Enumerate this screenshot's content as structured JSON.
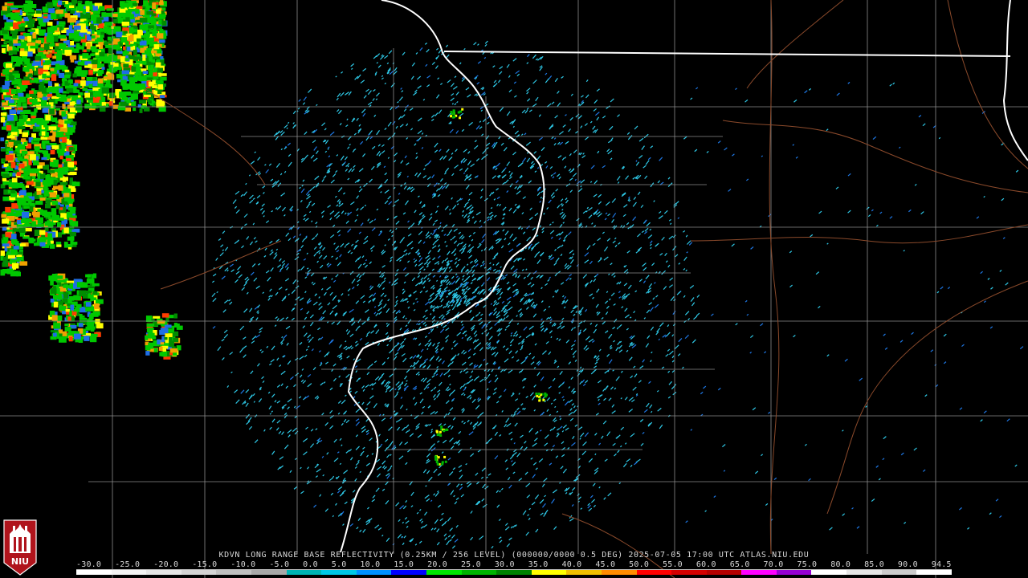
{
  "product": {
    "caption": "KDVN LONG RANGE BASE REFLECTIVITY (0.25KM / 256 LEVEL) (000000/0000 0.5 DEG) 2025-07-05 17:00 UTC  ATLAS.NIU.EDU"
  },
  "logo": {
    "text": "NIU",
    "icon": "niu-tower-logo-icon"
  },
  "colorbar": {
    "tick_labels": [
      "-30.0",
      "-25.0",
      "-20.0",
      "-15.0",
      "-10.0",
      "-5.0",
      "0.0",
      "5.0",
      "10.0",
      "15.0",
      "20.0",
      "25.0",
      "30.0",
      "35.0",
      "40.0",
      "45.0",
      "50.0",
      "55.0",
      "60.0",
      "65.0",
      "70.0",
      "75.0",
      "80.0",
      "85.0",
      "90.0",
      "94.5"
    ],
    "colors": [
      "#ffffff",
      "#f4f4f4",
      "#e6e6e6",
      "#d4d4d4",
      "#c0c0c0",
      "#a8a8a8",
      "#00b4b4",
      "#00c8e6",
      "#0090ff",
      "#0000ff",
      "#00e600",
      "#00b400",
      "#008200",
      "#ffff00",
      "#f0c000",
      "#ff8c00",
      "#ff0000",
      "#d40000",
      "#b40000",
      "#ff00ff",
      "#9600d2",
      "#ffffff",
      "#e6e6e6",
      "#cccccc",
      "#ffffff"
    ]
  },
  "map": {
    "radar_site": "KDVN",
    "boundary_color_state": "#ffffff",
    "boundary_color_county": "#8c8c8c",
    "highway_color": "#8b4a2b",
    "echo_color_main": "#2ec8e6"
  }
}
